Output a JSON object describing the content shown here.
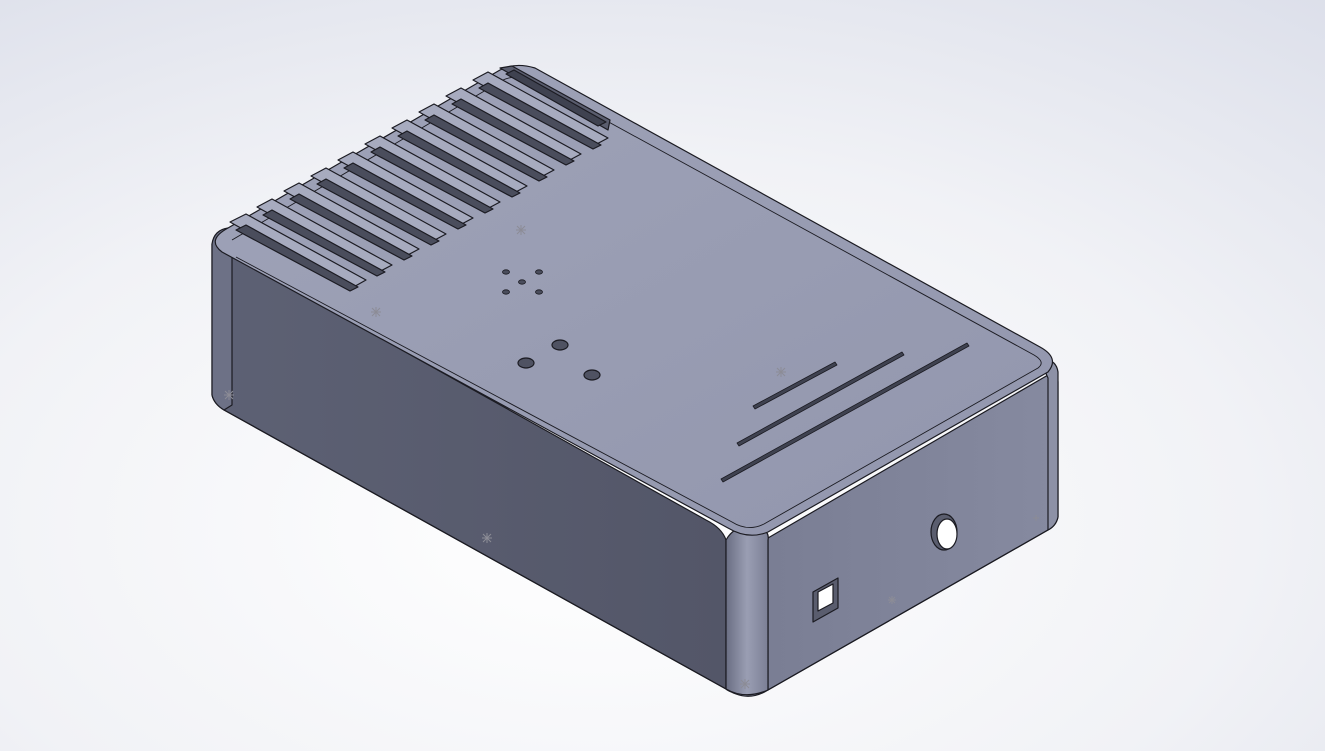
{
  "scene": {
    "view": "isometric",
    "model": "enclosure-box",
    "colors": {
      "background_top": "#dfe2ec",
      "background_bottom": "#f7f8fb",
      "top_face": "#989cb2",
      "left_face": "#565a6c",
      "right_face": "#81859b",
      "edge": "#1b1b22",
      "slot_fill": "#4a4d5c",
      "star_marker": "#8c8c96"
    },
    "features": {
      "vent_slot_count": 12,
      "small_hole_count": 5,
      "large_hole_count": 3,
      "top_line_slot_count": 3,
      "front_round_hole_count": 1,
      "front_square_cutout_count": 1
    }
  }
}
